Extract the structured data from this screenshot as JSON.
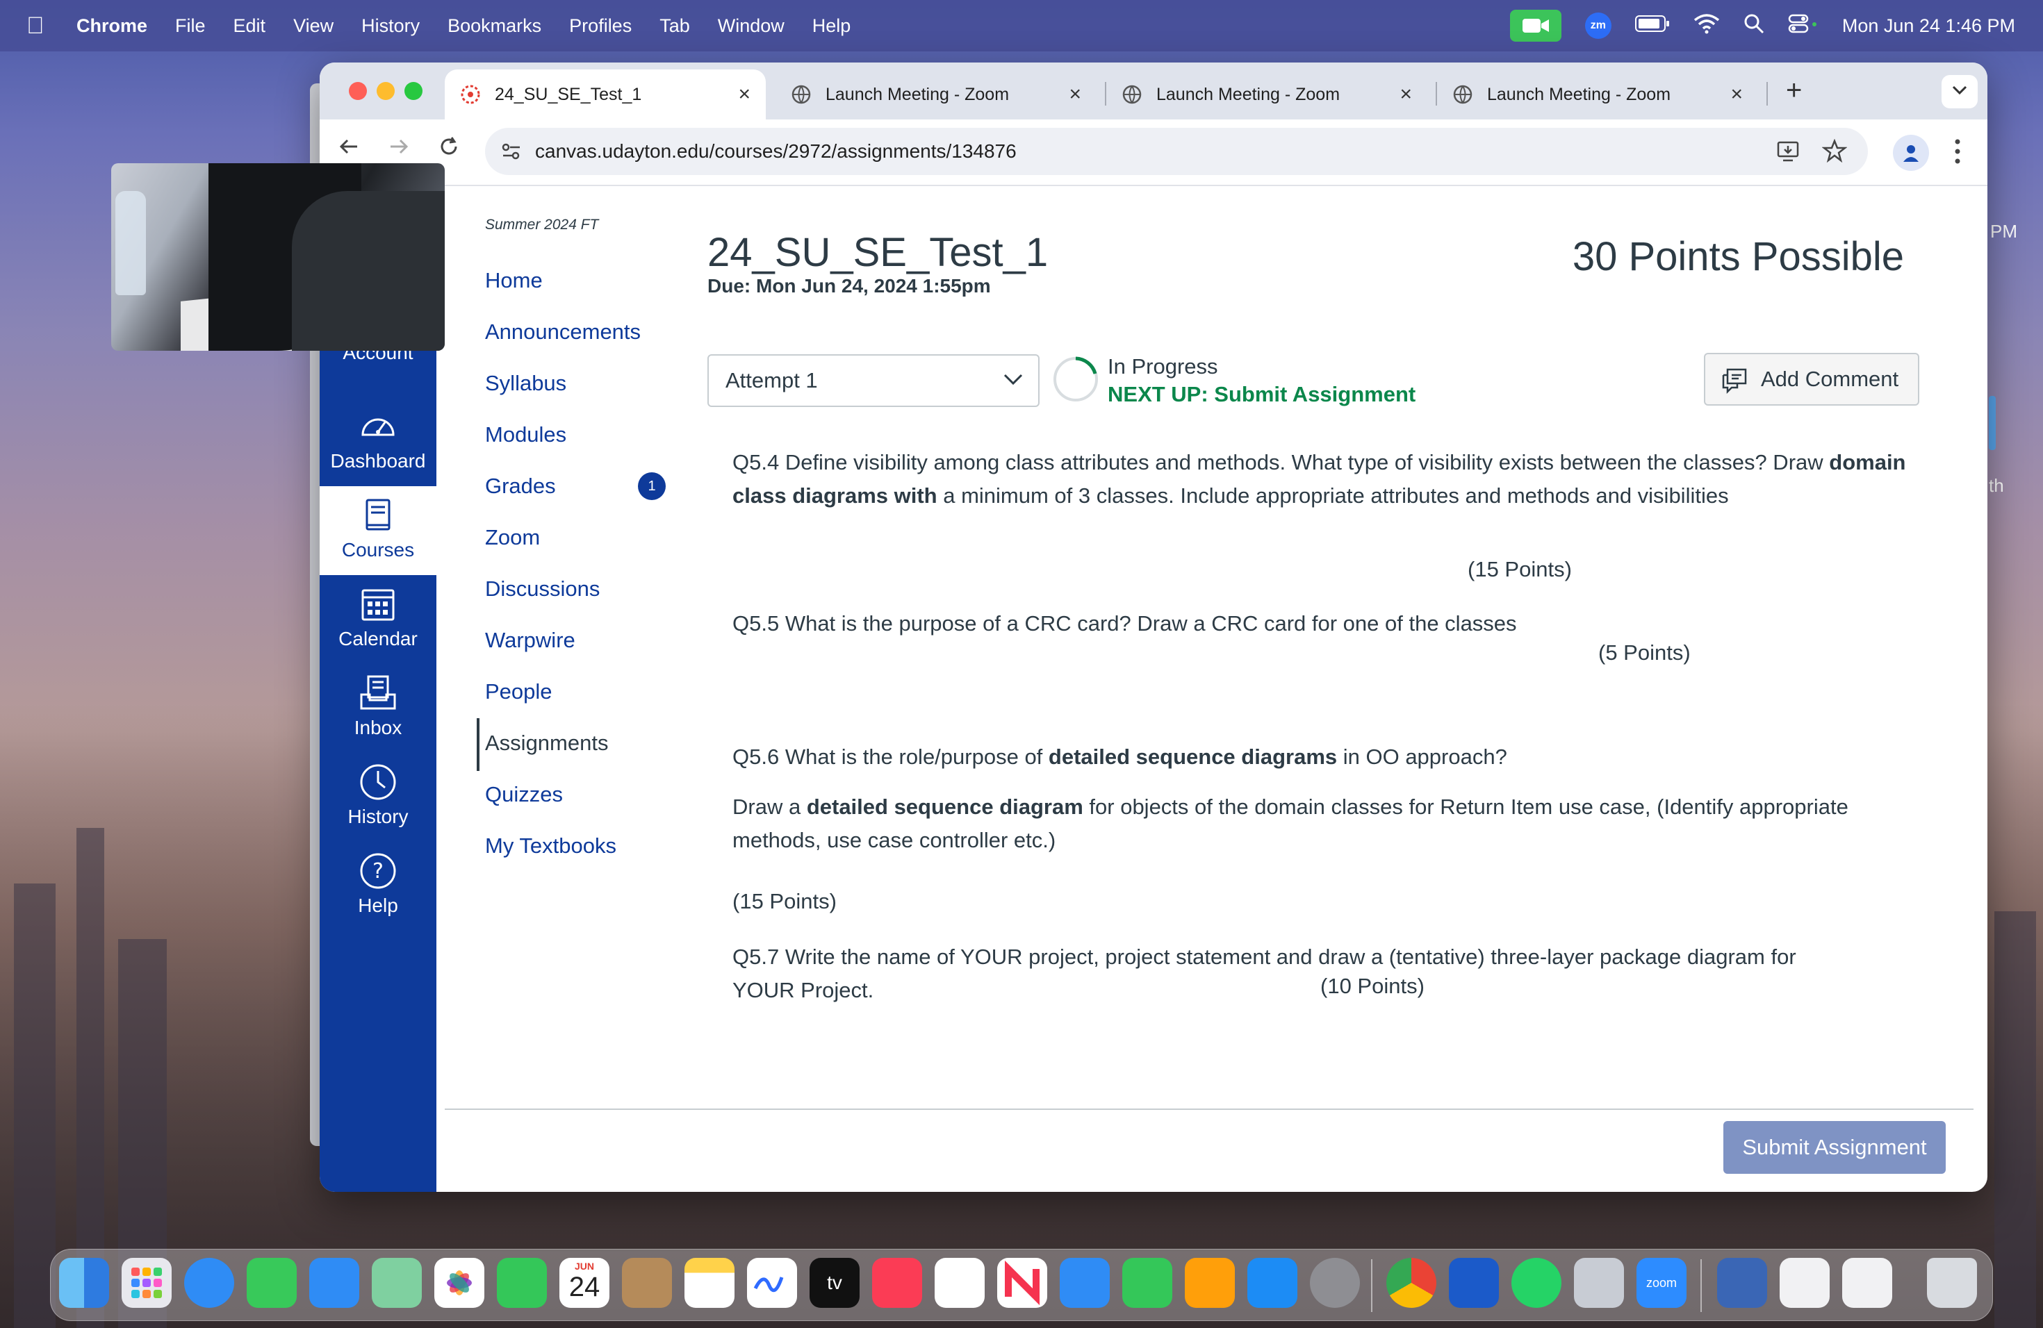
{
  "menubar": {
    "app": "Chrome",
    "items": [
      "File",
      "Edit",
      "View",
      "History",
      "Bookmarks",
      "Profiles",
      "Tab",
      "Window",
      "Help"
    ],
    "zoom_badge": "zm",
    "clock": "Mon Jun 24  1:46 PM"
  },
  "browser": {
    "tabs": [
      {
        "label": "24_SU_SE_Test_1",
        "icon": "canvas-icon",
        "active": true
      },
      {
        "label": "Launch Meeting - Zoom",
        "icon": "globe-icon"
      },
      {
        "label": "Launch Meeting - Zoom",
        "icon": "globe-icon"
      },
      {
        "label": "Launch Meeting - Zoom",
        "icon": "globe-icon"
      }
    ],
    "url": "canvas.udayton.edu/courses/2972/assignments/134876"
  },
  "global_nav": {
    "items": [
      {
        "label": "Account",
        "icon": "account-icon"
      },
      {
        "label": "Dashboard",
        "icon": "dashboard-icon"
      },
      {
        "label": "Courses",
        "icon": "courses-icon",
        "active": true
      },
      {
        "label": "Calendar",
        "icon": "calendar-icon"
      },
      {
        "label": "Inbox",
        "icon": "inbox-icon"
      },
      {
        "label": "History",
        "icon": "history-icon"
      },
      {
        "label": "Help",
        "icon": "help-icon"
      }
    ]
  },
  "course_nav": {
    "term": "Summer 2024 FT",
    "items": [
      "Home",
      "Announcements",
      "Syllabus",
      "Modules",
      "Grades",
      "Zoom",
      "Discussions",
      "Warpwire",
      "People",
      "Assignments",
      "Quizzes",
      "My Textbooks"
    ],
    "active": "Assignments",
    "grades_badge": "1"
  },
  "assignment": {
    "title": "24_SU_SE_Test_1",
    "due": "Due: Mon Jun 24, 2024 1:55pm",
    "points": "30 Points Possible",
    "attempt": "Attempt 1",
    "status": "In Progress",
    "next_up": "NEXT UP: Submit Assignment",
    "add_comment": "Add Comment",
    "submit": "Submit Assignment",
    "q54": {
      "a": "Q5.4 Define visibility among class attributes and methods.  What  type of visibility  exists between the classes? Draw ",
      "b": "domain class diagrams  with",
      "c": " a minimum of 3 classes.  Include   appropriate attributes and methods and visibilities",
      "points": "(15 Points)"
    },
    "q55": {
      "text": "Q5.5  What is the purpose of a CRC card? Draw a CRC card for one of the classes",
      "points": "(5 Points)"
    },
    "q56": {
      "a": "Q5.6  What is the role/purpose  of ",
      "b": "detailed sequence diagrams",
      "c": " in OO approach?",
      "d": "Draw a ",
      "e": "detailed sequence diagram",
      "f": " for objects of the domain classes  for Return Item use case, (Identify appropriate methods, use case controller etc.)",
      "points": "(15 Points)"
    },
    "q57": {
      "text": "Q5.7 Write the name of  YOUR project, project statement  and draw a (tentative) three-layer package diagram for YOUR Project.",
      "points": "(10 Points)"
    }
  },
  "dock": {
    "calendar_month": "JUN",
    "calendar_day": "24",
    "tv_label": "tv",
    "zoom_label": "zoom"
  },
  "background_edge": {
    "pm": "PM",
    "th": "th"
  }
}
